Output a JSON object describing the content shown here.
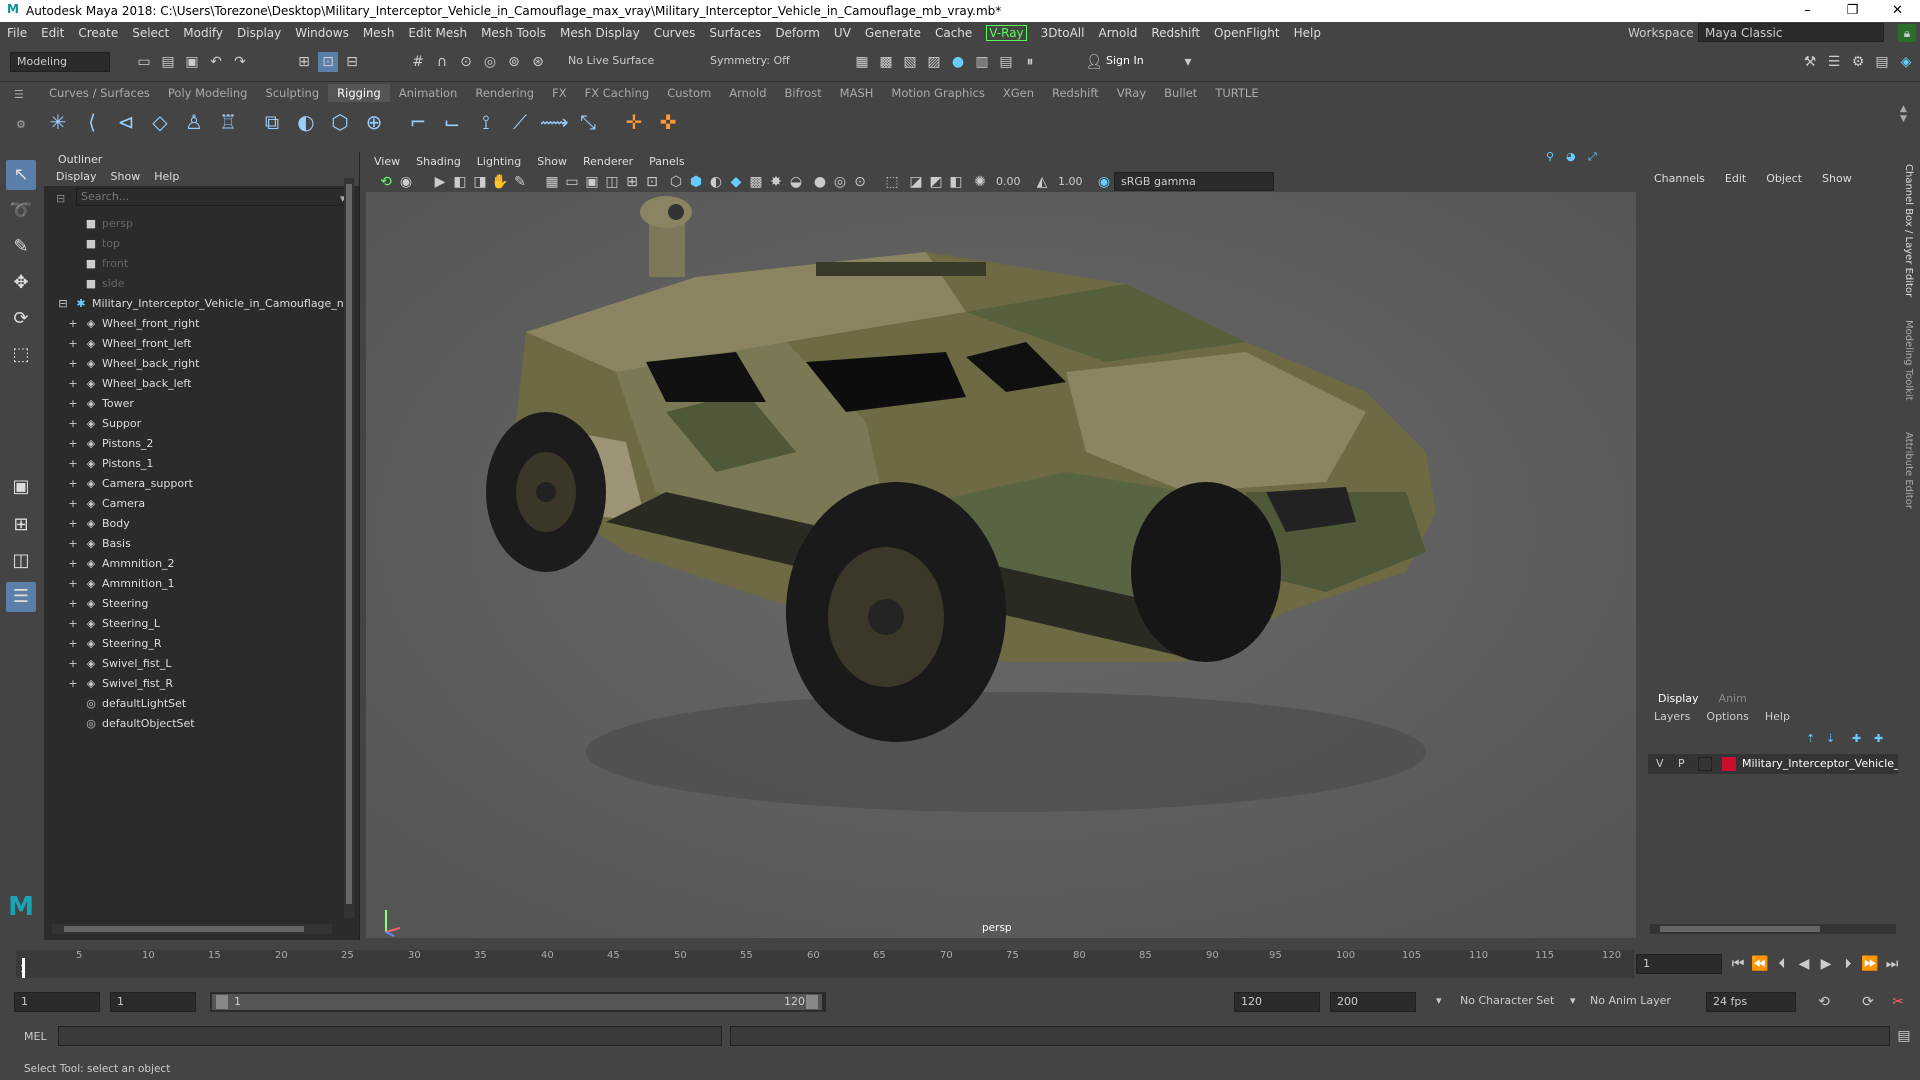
{
  "window": {
    "title": "Autodesk Maya 2018: C:\\Users\\Torezone\\Desktop\\Military_Interceptor_Vehicle_in_Camouflage_max_vray\\Military_Interceptor_Vehicle_in_Camouflage_mb_vray.mb*",
    "minimize": "–",
    "maximize": "❐",
    "close": "✕"
  },
  "menus": [
    "File",
    "Edit",
    "Create",
    "Select",
    "Modify",
    "Display",
    "Windows",
    "Mesh",
    "Edit Mesh",
    "Mesh Tools",
    "Mesh Display",
    "Curves",
    "Surfaces",
    "Deform",
    "UV",
    "Generate",
    "Cache",
    "V-Ray",
    "3DtoAll",
    "Arnold",
    "Redshift",
    "OpenFlight",
    "Help"
  ],
  "workspace": {
    "label": "Workspace :",
    "value": "Maya Classic"
  },
  "statusline": {
    "mode": "Modeling",
    "live_surface": "No Live Surface",
    "symmetry": "Symmetry: Off",
    "sign_in": "Sign In"
  },
  "shelf_tabs": [
    "Curves / Surfaces",
    "Poly Modeling",
    "Sculpting",
    "Rigging",
    "Animation",
    "Rendering",
    "FX",
    "FX Caching",
    "Custom",
    "Arnold",
    "Bifrost",
    "MASH",
    "Motion Graphics",
    "XGen",
    "Redshift",
    "VRay",
    "Bullet",
    "TURTLE"
  ],
  "shelf_active": "Rigging",
  "outliner": {
    "title": "Outliner",
    "menu": [
      "Display",
      "Show",
      "Help"
    ],
    "search_placeholder": "Search...",
    "cameras": [
      "persp",
      "top",
      "front",
      "side"
    ],
    "root": "Military_Interceptor_Vehicle_in_Camouflage_nc",
    "children": [
      "Wheel_front_right",
      "Wheel_front_left",
      "Wheel_back_right",
      "Wheel_back_left",
      "Tower",
      "Suppor",
      "Pistons_2",
      "Pistons_1",
      "Camera_support",
      "Camera",
      "Body",
      "Basis",
      "Ammnition_2",
      "Ammnition_1",
      "Steering",
      "Steering_L",
      "Steering_R",
      "Swivel_fist_L",
      "Swivel_fist_R"
    ],
    "sets": [
      "defaultLightSet",
      "defaultObjectSet"
    ]
  },
  "viewport": {
    "menu": [
      "View",
      "Shading",
      "Lighting",
      "Show",
      "Renderer",
      "Panels"
    ],
    "exposure": "0.00",
    "gamma": "1.00",
    "colorspace": "sRGB gamma",
    "camera_label": "persp"
  },
  "channelbox": {
    "menu": [
      "Channels",
      "Edit",
      "Object",
      "Show"
    ]
  },
  "layers": {
    "tabs": [
      "Display",
      "Anim"
    ],
    "menu": [
      "Layers",
      "Options",
      "Help"
    ],
    "row": {
      "v": "V",
      "p": "P",
      "name": "Military_Interceptor_Vehicle_in",
      "color": "#c8102e"
    }
  },
  "side_tabs": [
    "Channel Box / Layer Editor",
    "Modeling Toolkit",
    "Attribute Editor"
  ],
  "timeline": {
    "ticks": [
      "5",
      "10",
      "15",
      "20",
      "25",
      "30",
      "35",
      "40",
      "45",
      "50",
      "55",
      "60",
      "65",
      "70",
      "75",
      "80",
      "85",
      "90",
      "95",
      "100",
      "105",
      "110",
      "115",
      "120"
    ],
    "start": "1",
    "current": "1"
  },
  "range": {
    "start": "1",
    "anim_start": "1",
    "slider_start": "1",
    "slider_end": "120",
    "end": "120",
    "anim_end": "200",
    "char_set": "No Character Set",
    "anim_layer": "No Anim Layer",
    "fps": "24 fps"
  },
  "cmdline": {
    "label": "MEL"
  },
  "helpline": "Select Tool: select an object",
  "colors": {
    "accent": "#5a7fa8",
    "vray": "#55ff55",
    "maya_logo": "#19a3b5"
  }
}
